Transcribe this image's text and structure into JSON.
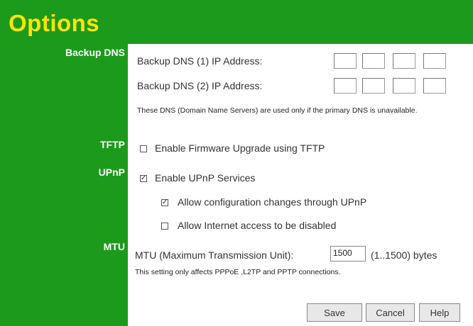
{
  "title": "Options",
  "sections": {
    "backup_dns": "Backup DNS",
    "tftp": "TFTP",
    "upnp": "UPnP",
    "mtu": "MTU"
  },
  "backup_dns": {
    "dns1_label": "Backup DNS (1) IP Address:",
    "dns2_label": "Backup DNS (2) IP Address:",
    "note": "These DNS (Domain Name Servers) are used only if the primary DNS is unavailable."
  },
  "tftp": {
    "checkbox_label": "Enable Firmware Upgrade using TFTP",
    "checked": false
  },
  "upnp": {
    "enable_label": "Enable UPnP Services",
    "enable_checked": true,
    "allow_config_label": "Allow configuration changes through UPnP",
    "allow_config_checked": true,
    "allow_disable_label": "Allow Internet access to be disabled",
    "allow_disable_checked": false
  },
  "mtu": {
    "label": "MTU (Maximum Transmission Unit):",
    "value": "1500",
    "range": "(1..1500) bytes",
    "note": "This setting only affects PPPoE ,L2TP and PPTP connections."
  },
  "buttons": {
    "save": "Save",
    "cancel": "Cancel",
    "help": "Help"
  },
  "colors": {
    "sidebar_green": "#1c9a1c",
    "title_yellow": "#ffe400"
  }
}
